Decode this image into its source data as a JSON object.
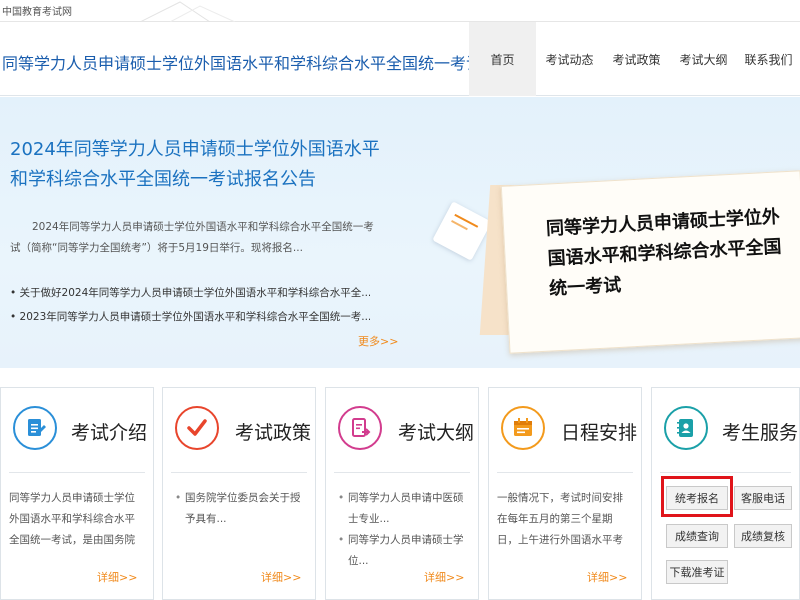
{
  "site_name": "中国教育考试网",
  "header": {
    "title": "同等学力人员申请硕士学位外国语水平和学科综合水平全国统一考试",
    "nav": [
      "首页",
      "考试动态",
      "考试政策",
      "考试大纲",
      "联系我们"
    ]
  },
  "banner": {
    "title": "2024年同等学力人员申请硕士学位外国语水平和学科综合水平全国统一考试报名公告",
    "intro": "2024年同等学力人员申请硕士学位外国语水平和学科综合水平全国统一考试（简称“同等学力全国统考”）将于5月19日举行。现将报名...",
    "news": [
      "关于做好2024年同等学力人员申请硕士学位外国语水平和学科综合水平全...",
      "2023年同等学力人员申请硕士学位外国语水平和学科综合水平全国统一考..."
    ],
    "more": "更多>>",
    "poster_text": "同等学力人员申请硕士学位外国语水平和学科综合水平全国统一考试"
  },
  "cards": {
    "intro": {
      "title": "考试介绍",
      "text": "同等学力人员申请硕士学位外国语水平和学科综合水平全国统一考试，是由国务院学位委",
      "detail": "详细>>"
    },
    "policy": {
      "title": "考试政策",
      "items": [
        "国务院学位委员会关于授予具有..."
      ],
      "detail": "详细>>"
    },
    "syllabus": {
      "title": "考试大纲",
      "items": [
        "同等学力人员申请中医硕士专业...",
        "同等学力人员申请硕士学位..."
      ],
      "detail": "详细>>"
    },
    "schedule": {
      "title": "日程安排",
      "text": "一般情况下，考试时间安排在每年五月的第三个星期日，上午进行外国语水平考试和医古",
      "detail": "详细>>"
    },
    "service": {
      "title": "考生服务",
      "buttons": {
        "register": "统考报名",
        "hotline": "客服电话",
        "score_query": "成绩查询",
        "score_review": "成绩复核",
        "admit_card": "下载准考证"
      }
    }
  },
  "colors": {
    "title_blue": "#1a5dad",
    "banner_blue": "#1b72c0",
    "more_orange": "#f08a1c",
    "highlight_red": "#e0141a",
    "intro_icon": "#2a8fd8",
    "policy_icon": "#e8452c",
    "syllabus_icon": "#d23c8e",
    "schedule_icon": "#f39a1c",
    "service_icon": "#1aa0a8"
  }
}
